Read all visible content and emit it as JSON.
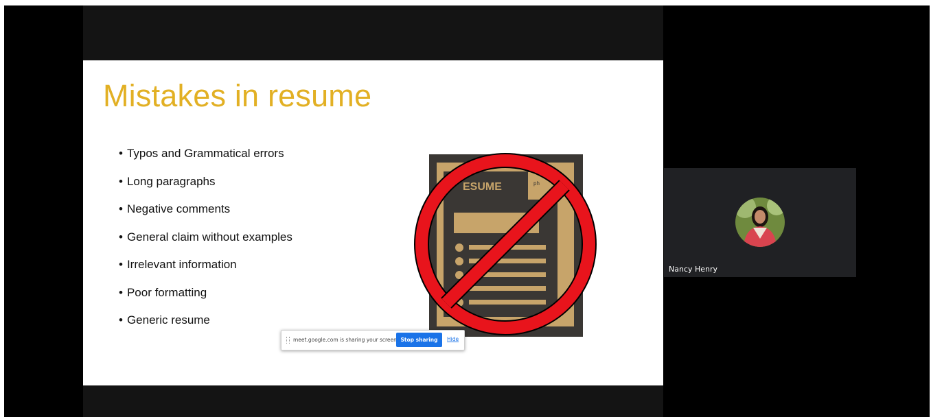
{
  "slide": {
    "title": "Mistakes in resume",
    "bullets": [
      "Typos and Grammatical errors",
      "Long paragraphs",
      "Negative comments",
      "General claim without examples",
      "Irrelevant information",
      "Poor formatting",
      "Generic resume"
    ],
    "illustration": {
      "heading": "ESUME",
      "photo_label": "ph",
      "colors": {
        "tan": "#c7a46a",
        "dark": "#3a3734",
        "prohibit": "#e8141c"
      }
    }
  },
  "share_bar": {
    "message": "meet.google.com is sharing your screen.",
    "stop_label": "Stop sharing",
    "hide_label": "Hide"
  },
  "participant": {
    "name": "Nancy Henry"
  },
  "colors": {
    "title": "#e2b024",
    "accent": "#1a73e8",
    "tile": "#202124"
  }
}
